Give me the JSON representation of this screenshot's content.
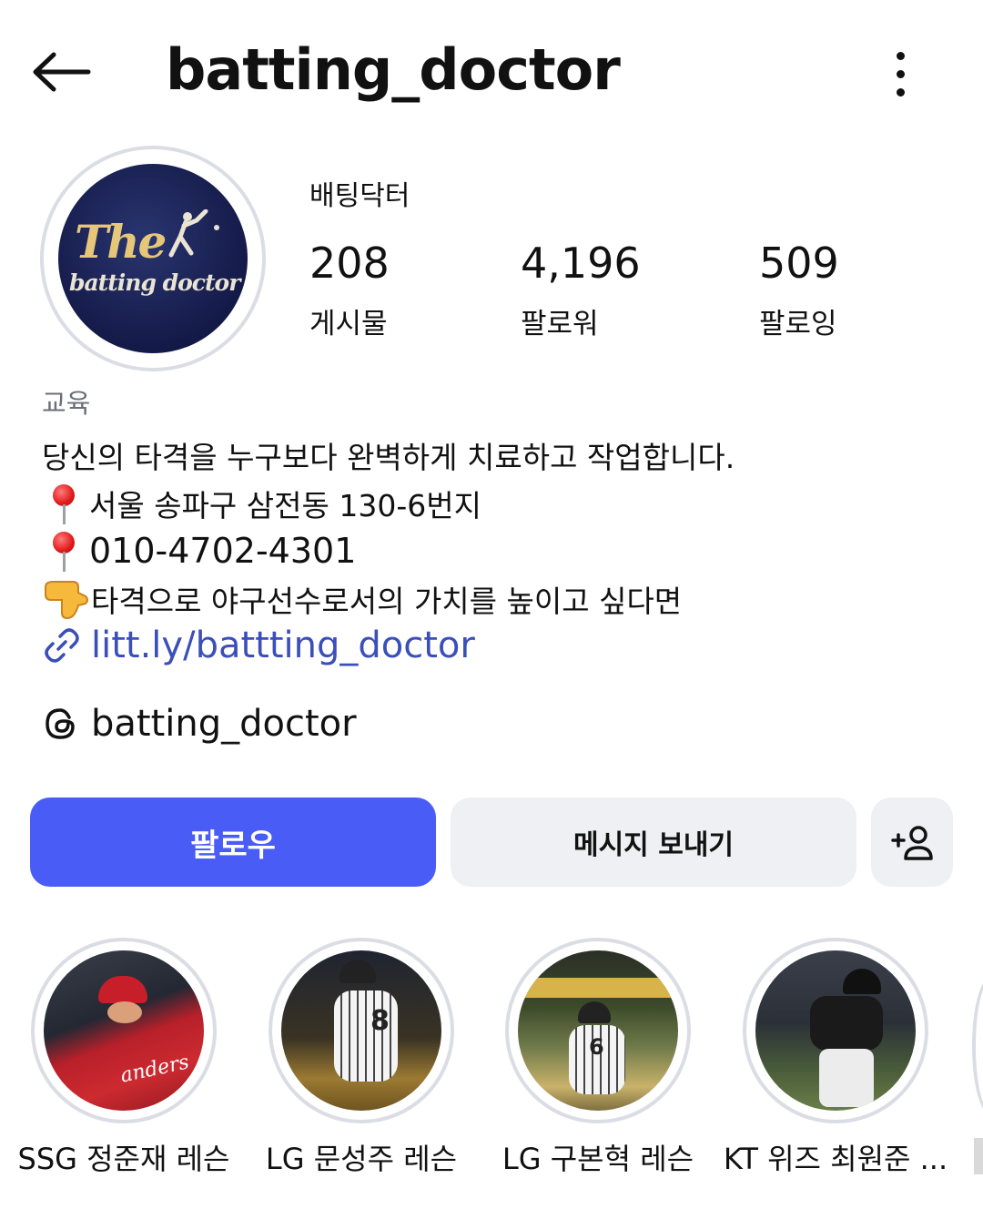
{
  "header": {
    "title": "batting_doctor",
    "back_icon": "arrow-left-icon",
    "more_icon": "more-vertical-icon"
  },
  "profile": {
    "display_name": "배팅닥터",
    "avatar_text_main": "The",
    "avatar_text_sub": "batting doctor",
    "stats": [
      {
        "value": "208",
        "label": "게시물"
      },
      {
        "value": "4,196",
        "label": "팔로워"
      },
      {
        "value": "509",
        "label": "팔로잉"
      }
    ]
  },
  "bio": {
    "category": "교육",
    "line1": "당신의 타격을 누구보다 완벽하게 치료하고 작업합니다.",
    "line2": "서울 송파구 삼전동 130-6번지",
    "line3": "010-4702-4301",
    "line4": "타격으로 야구선수로서의 가치를 높이고 싶다면",
    "link": "litt.ly/battting_doctor",
    "threads_handle": "batting_doctor"
  },
  "actions": {
    "follow_label": "팔로우",
    "message_label": "메시지 보내기",
    "add_user_icon": "add-person-icon"
  },
  "highlights": [
    {
      "label": "SSG 정준재 레슨"
    },
    {
      "label": "LG 문성주 레슨"
    },
    {
      "label": "LG 구본혁 레슨"
    },
    {
      "label": "KT 위즈 최원준 ..."
    }
  ],
  "colors": {
    "accent": "#4a5cf6",
    "link": "#3b4fb8",
    "secondary_button": "#eff0f3",
    "ring": "#dbdde5"
  }
}
